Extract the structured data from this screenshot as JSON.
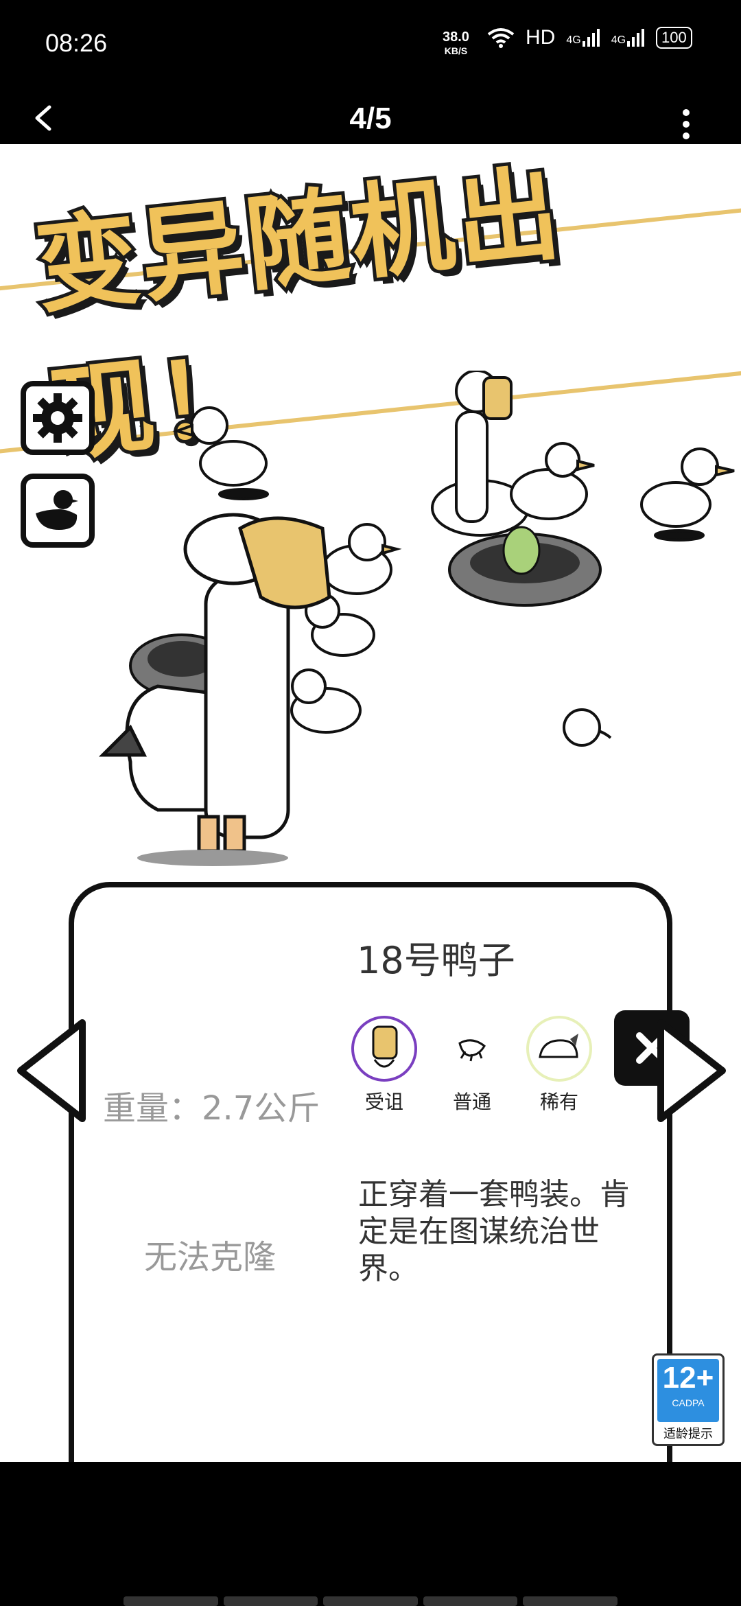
{
  "status": {
    "time": "08:26",
    "net_speed": "38.0",
    "net_unit": "KB/S",
    "hd": "HD",
    "signal1": "4G",
    "signal2": "4G",
    "battery": "100"
  },
  "nav": {
    "counter": "4/5"
  },
  "banner": {
    "text": "变异随机出现！"
  },
  "card": {
    "name": "18号鸭子",
    "weight": "重量：2.7公斤",
    "clone_status": "无法克隆",
    "description": "正穿着一套鸭装。肯定是在图谋统治世界。",
    "traits": [
      {
        "label": "受诅",
        "icon": "cursed-mask-icon",
        "ring": "#7a3fc0"
      },
      {
        "label": "普通",
        "icon": "duck-foot-icon",
        "ring": "#ffffff"
      },
      {
        "label": "稀有",
        "icon": "fluffy-tail-icon",
        "ring": "#e7f0b8"
      }
    ]
  },
  "age_badge": {
    "rating": "12+",
    "org": "CADPA",
    "label": "适龄提示"
  }
}
